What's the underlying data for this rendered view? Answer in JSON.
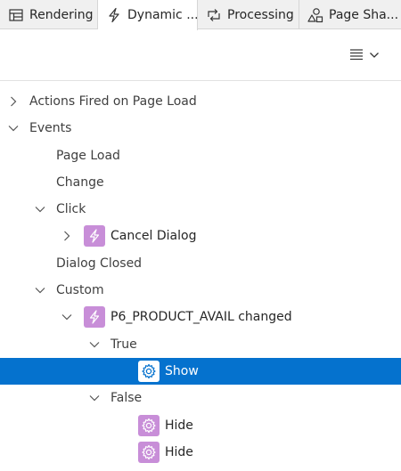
{
  "tabs": [
    {
      "label": "Rendering",
      "icon": "table-icon"
    },
    {
      "label": "Dynamic ...",
      "icon": "lightning-icon"
    },
    {
      "label": "Processing",
      "icon": "cycle-arrows-icon"
    },
    {
      "label": "Page Sha...",
      "icon": "shapes-icon"
    }
  ],
  "toolbar": {
    "menu_icon": "hamburger-menu-icon"
  },
  "tree": {
    "actions_on_load": "Actions Fired on Page Load",
    "events": "Events",
    "page_load": "Page Load",
    "change": "Change",
    "click": "Click",
    "cancel_dialog": "Cancel Dialog",
    "dialog_closed": "Dialog Closed",
    "custom": "Custom",
    "p6_changed": "P6_PRODUCT_AVAIL changed",
    "true_branch": "True",
    "show": "Show",
    "false_branch": "False",
    "hide1": "Hide",
    "hide2": "Hide"
  },
  "colors": {
    "selected": "#0572ce",
    "dynamic_action_icon": "#c88ed8"
  }
}
